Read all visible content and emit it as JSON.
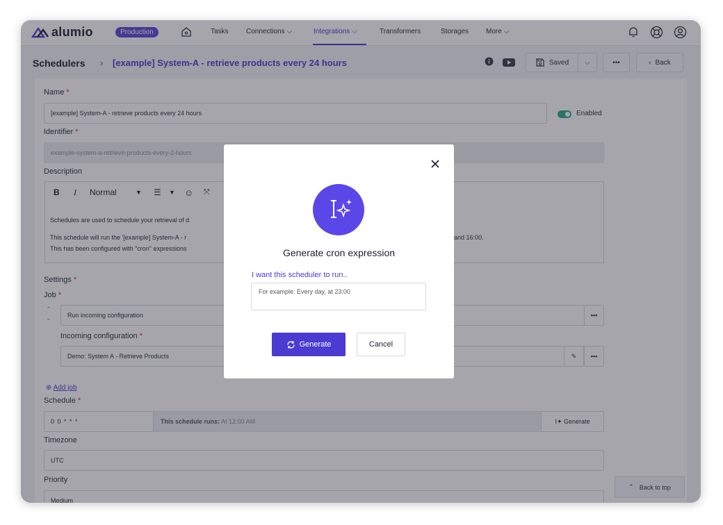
{
  "app": {
    "logo_text": "alumio",
    "environment": "Production"
  },
  "nav": {
    "items": [
      {
        "label": "Tasks"
      },
      {
        "label": "Connections"
      },
      {
        "label": "Integrations"
      },
      {
        "label": "Transformers"
      },
      {
        "label": "Storages"
      },
      {
        "label": "More"
      }
    ],
    "active": "Integrations"
  },
  "header": {
    "section": "Schedulers",
    "current": "[example] System-A - retrieve products every 24 hours",
    "saved_label": "Saved",
    "more_label": "•••",
    "back_label": "Back"
  },
  "form": {
    "name_label": "Name",
    "name_value": "[example] System-A - retrieve products every 24 hours",
    "enabled_label": "Enabled",
    "identifier_label": "Identifier",
    "identifier_value": "example-system-a-retrieve-products-every-2-hours",
    "description_label": "Description",
    "editor_style": "Normal",
    "desc_line1": "Schedules are used to schedule your retrieval of d",
    "desc_line2": "This schedule will run the '[example] System-A - r",
    "desc_line2_end": "and 16:00.",
    "desc_line3": "This has been configured with \"cron\" expressions",
    "settings_label": "Settings",
    "job_label": "Job",
    "job_value": "Run incoming configuration",
    "incoming_label": "Incoming configuration",
    "incoming_value": "Demo: System A - Retrieve Products",
    "add_job": "Add job",
    "schedule_label": "Schedule",
    "schedule_value": "0 0 * * *",
    "schedule_info_prefix": "This schedule runs:",
    "schedule_info_value": "At 12:00 AM",
    "generate_label": "Generate",
    "timezone_label": "Timezone",
    "timezone_value": "UTC",
    "priority_label": "Priority",
    "priority_value": "Medium",
    "back_to_top": "Back to top"
  },
  "modal": {
    "title": "Generate cron expression",
    "prompt_label": "I want this scheduler to run..",
    "input_placeholder": "For example: Every day, at 23:00",
    "generate_button": "Generate",
    "cancel_button": "Cancel"
  },
  "colors": {
    "accent": "#4b3bd1",
    "toggle": "#2aa889",
    "badge": "#5b46d6"
  }
}
